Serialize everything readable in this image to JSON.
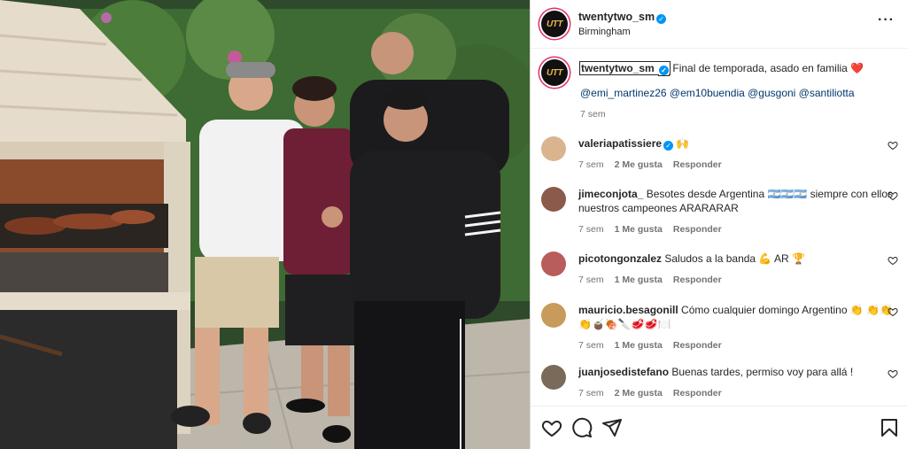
{
  "post": {
    "username": "twentytwo_sm",
    "location": "Birmingham",
    "avatar_text": "UTT",
    "more_icon": "more-options-icon"
  },
  "caption": {
    "username": "twentytwo_sm",
    "text": "Final de temporada, asado en familia ❤️",
    "mentions": "@emi_martinez26 @em10buendia @gusgoni @santiliotta",
    "time": "7 sem"
  },
  "comments": [
    {
      "user": "valeriapatissiere",
      "verified": true,
      "text": "🙌",
      "time": "7 sem",
      "likes": "2 Me gusta",
      "reply": "Responder",
      "avatar_color": "#d9b48f"
    },
    {
      "user": "jimeconjota_",
      "verified": false,
      "text": "Besotes desde Argentina 🇦🇷🇦🇷🇦🇷 siempre con ellos nuestros campeones ARARARAR",
      "time": "7 sem",
      "likes": "1 Me gusta",
      "reply": "Responder",
      "avatar_color": "#8b5a4a"
    },
    {
      "user": "picotongonzalez",
      "verified": false,
      "text": "Saludos a la banda 💪 AR 🏆",
      "time": "7 sem",
      "likes": "1 Me gusta",
      "reply": "Responder",
      "avatar_color": "#b85c5c"
    },
    {
      "user": "mauricio.besagonill",
      "verified": false,
      "text": "Cómo cualquier domingo Argentino 👏 👏👏👏🧉🍖🔪🥩🥩🍽️",
      "time": "7 sem",
      "likes": "1 Me gusta",
      "reply": "Responder",
      "avatar_color": "#c89a5b"
    },
    {
      "user": "juanjosedistefano",
      "verified": false,
      "text": "Buenas tardes, permiso voy para allá !",
      "time": "7 sem",
      "likes": "2 Me gusta",
      "reply": "Responder",
      "avatar_color": "#7a6a5a"
    }
  ],
  "actions": [
    "heart-icon",
    "comment-icon",
    "share-icon",
    "save-icon"
  ],
  "colors": {
    "verified": "#0095f6",
    "mention": "#00376b",
    "meta": "#737373",
    "ring": "#e1306c"
  }
}
